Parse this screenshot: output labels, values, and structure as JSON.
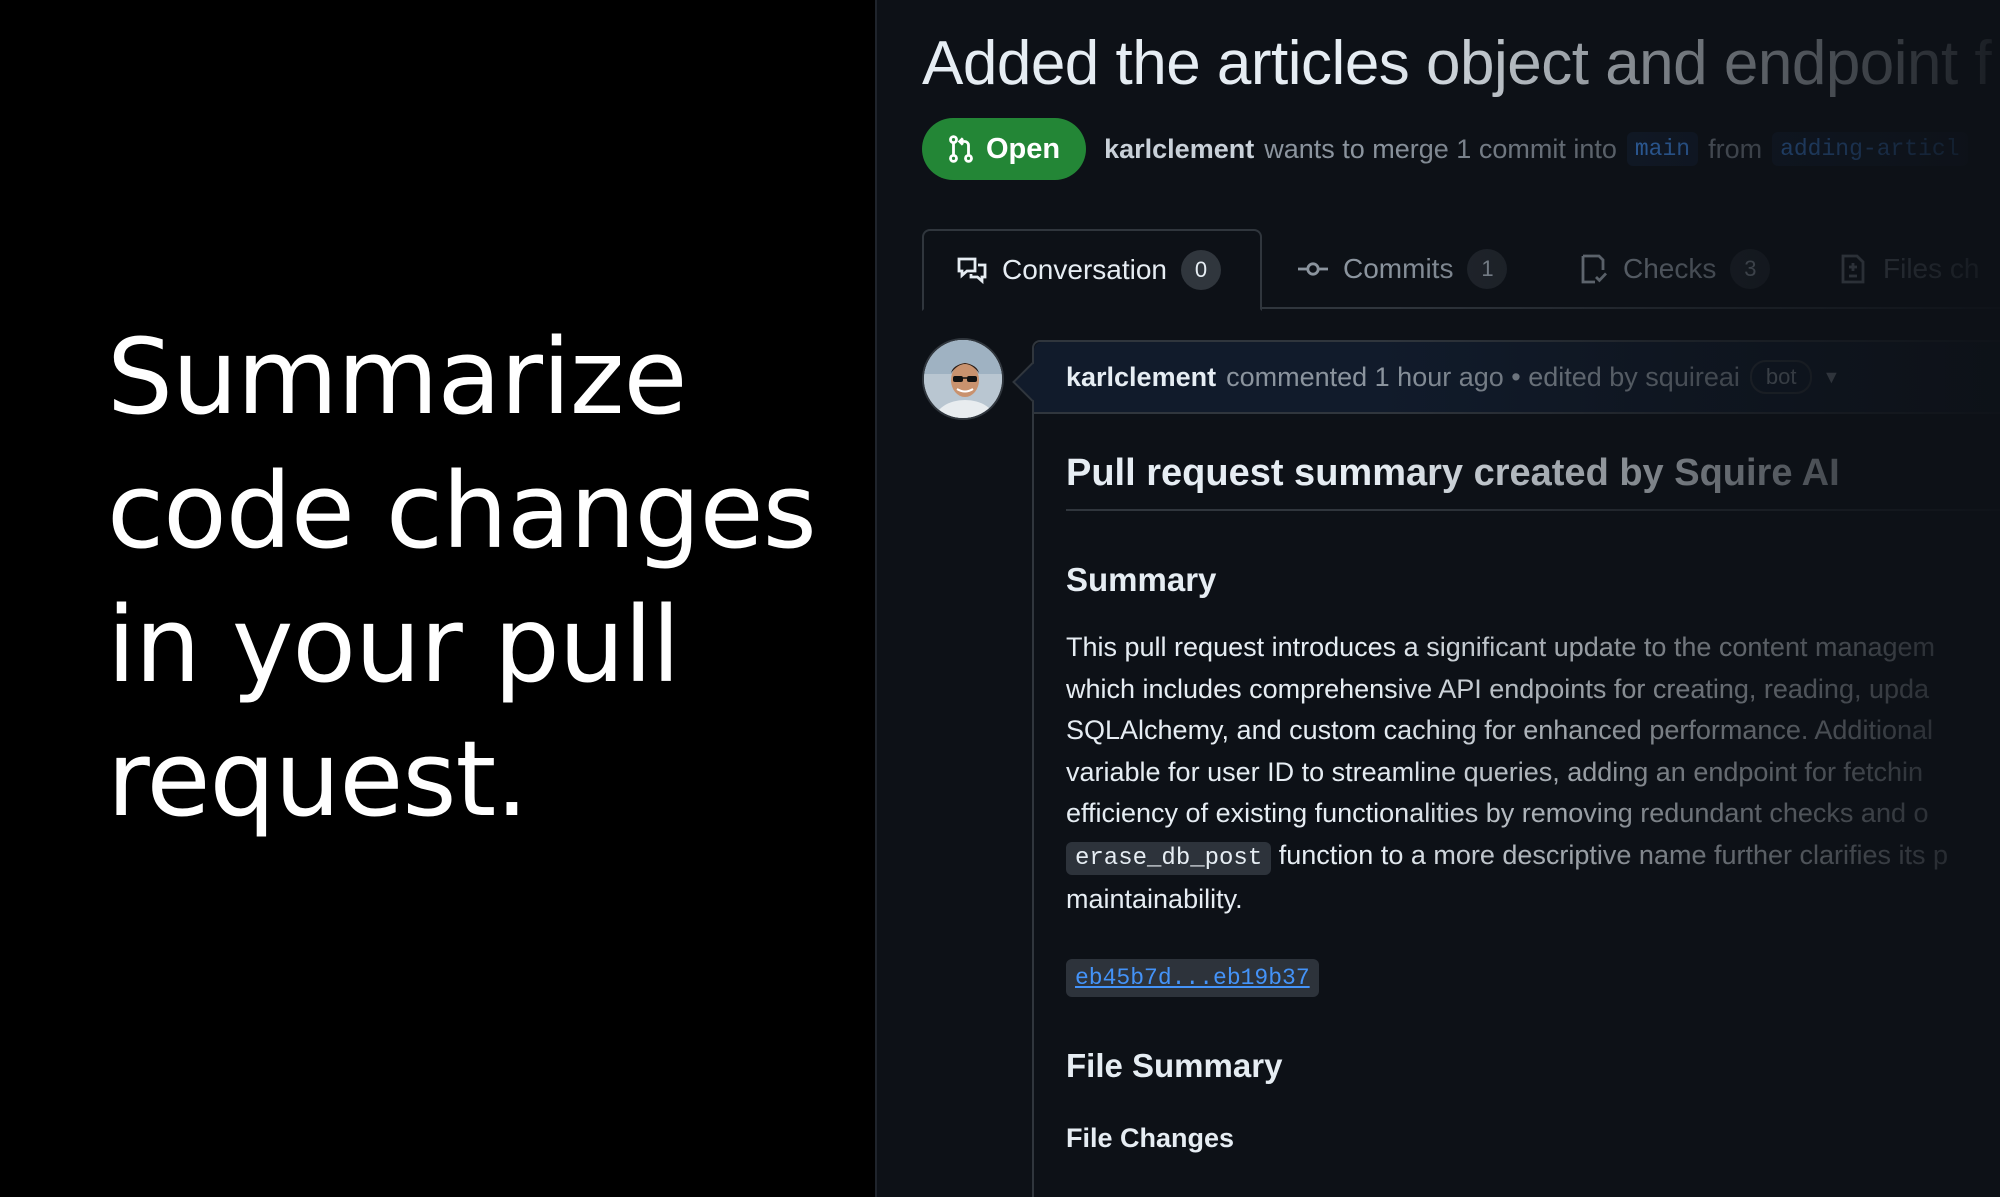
{
  "promo": {
    "line1": "Summarize",
    "line2": "code changes",
    "line3": "in your pull",
    "line4": "request."
  },
  "pr": {
    "title": "Added the articles object and endpoint f",
    "state": "Open",
    "author": "karlclement",
    "merge_text": "wants to merge 1 commit into",
    "base_branch": "main",
    "from_text": "from",
    "head_branch": "adding-articl"
  },
  "tabs": [
    {
      "label": "Conversation",
      "count": "0",
      "icon": "comment-discussion-icon"
    },
    {
      "label": "Commits",
      "count": "1",
      "icon": "git-commit-icon"
    },
    {
      "label": "Checks",
      "count": "3",
      "icon": "checklist-icon"
    },
    {
      "label": "Files ch",
      "icon": "file-diff-icon"
    }
  ],
  "comment": {
    "author": "karlclement",
    "meta": "commented 1 hour ago • edited by squireai",
    "bot_label": "bot",
    "heading": "Pull request summary created by Squire AI",
    "summary_heading": "Summary",
    "summary_lines": [
      "This pull request introduces a significant update to the content managem",
      "which includes comprehensive API endpoints for creating, reading, upda",
      "SQLAlchemy, and custom caching for enhanced performance. Additional",
      "variable for user ID to streamline queries, adding an endpoint for fetchin",
      "efficiency of existing functionalities by removing redundant checks and o"
    ],
    "code_token": "erase_db_post",
    "summary_line6_rest": "function to a more descriptive name further clarifies its p",
    "summary_line7": "maintainability.",
    "commit_range": "eb45b7d...eb19b37",
    "file_summary_heading": "File Summary",
    "file_changes_heading": "File Changes"
  },
  "colors": {
    "background": "#000000",
    "panel": "#0d1117",
    "open_green": "#238636",
    "link_blue": "#4493f8"
  }
}
